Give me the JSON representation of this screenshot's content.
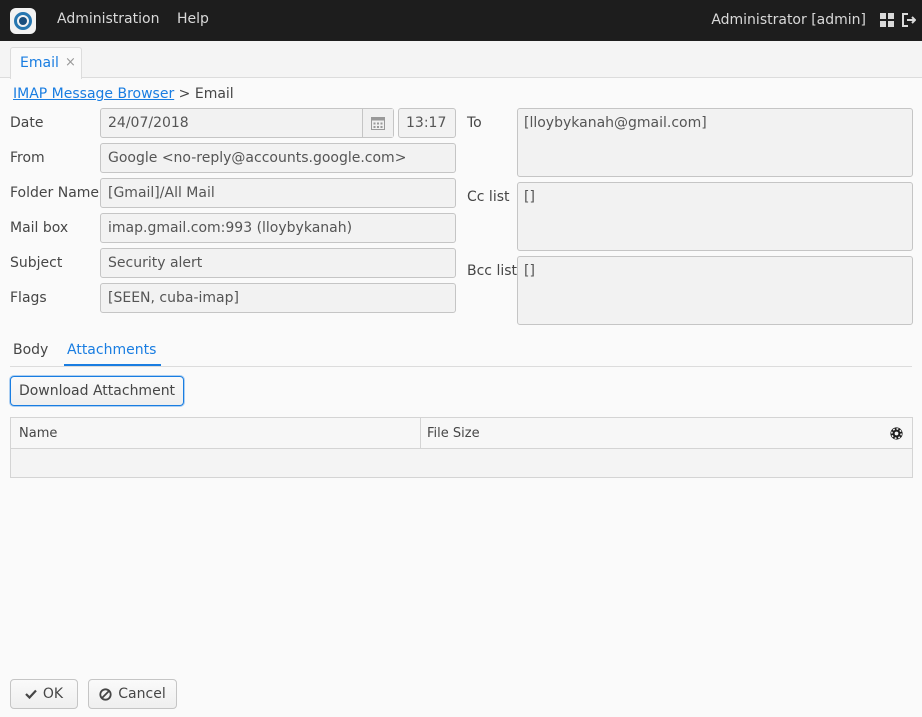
{
  "header": {
    "menu": [
      "Administration",
      "Help"
    ],
    "user": "Administrator [admin]",
    "icons": [
      "logo-icon",
      "app-menu-icon",
      "logout-icon"
    ]
  },
  "tabs": [
    {
      "label": "Email",
      "close": "×"
    }
  ],
  "breadcrumb": {
    "link": "IMAP Message Browser",
    "current": "> Email"
  },
  "form": {
    "date_label": "Date",
    "date_value": "24/07/2018",
    "time_value": "13:17",
    "from_label": "From",
    "from_value": "Google <no-reply@accounts.google.com>",
    "folder_label": "Folder Name",
    "folder_value": "[Gmail]/All Mail",
    "mailbox_label": "Mail box",
    "mailbox_value": "imap.gmail.com:993 (lloybykanah)",
    "subject_label": "Subject",
    "subject_value": "Security alert",
    "flags_label": "Flags",
    "flags_value": "[SEEN, cuba-imap]",
    "to_label": "To",
    "to_value": "[lloybykanah@gmail.com]",
    "cc_label": "Cc list",
    "cc_value": "[]",
    "bcc_label": "Bcc list",
    "bcc_value": "[]"
  },
  "subtabs": {
    "body": "Body",
    "attachments": "Attachments",
    "active": "Attachments"
  },
  "download_label": "Download Attachment",
  "table": {
    "columns": [
      "Name",
      "File Size"
    ],
    "rows": []
  },
  "footer": {
    "ok": "OK",
    "cancel": "Cancel"
  },
  "colors": {
    "accent": "#197de1",
    "topbar": "#1d1d1d"
  }
}
